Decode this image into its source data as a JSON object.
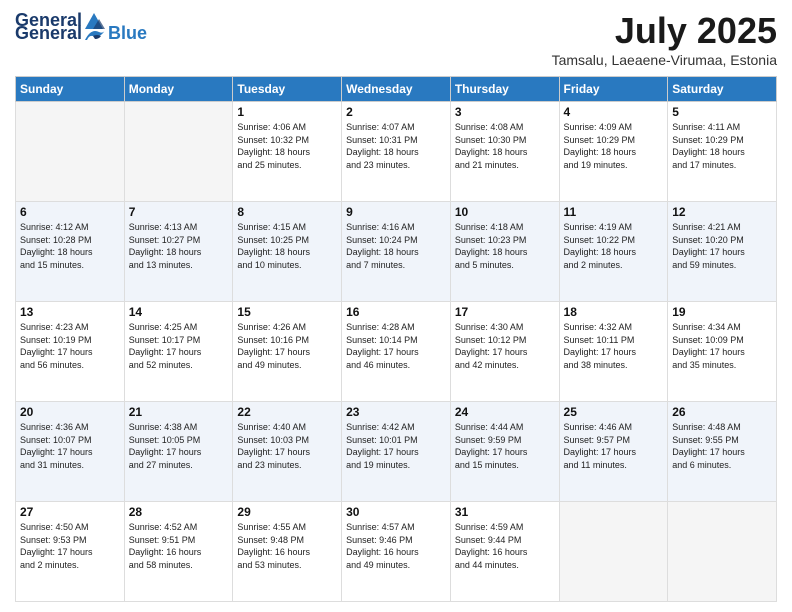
{
  "header": {
    "logo_general": "General",
    "logo_blue": "Blue",
    "title": "July 2025",
    "location": "Tamsalu, Laeaene-Virumaa, Estonia"
  },
  "days_of_week": [
    "Sunday",
    "Monday",
    "Tuesday",
    "Wednesday",
    "Thursday",
    "Friday",
    "Saturday"
  ],
  "weeks": [
    [
      {
        "day": "",
        "info": ""
      },
      {
        "day": "",
        "info": ""
      },
      {
        "day": "1",
        "info": "Sunrise: 4:06 AM\nSunset: 10:32 PM\nDaylight: 18 hours\nand 25 minutes."
      },
      {
        "day": "2",
        "info": "Sunrise: 4:07 AM\nSunset: 10:31 PM\nDaylight: 18 hours\nand 23 minutes."
      },
      {
        "day": "3",
        "info": "Sunrise: 4:08 AM\nSunset: 10:30 PM\nDaylight: 18 hours\nand 21 minutes."
      },
      {
        "day": "4",
        "info": "Sunrise: 4:09 AM\nSunset: 10:29 PM\nDaylight: 18 hours\nand 19 minutes."
      },
      {
        "day": "5",
        "info": "Sunrise: 4:11 AM\nSunset: 10:29 PM\nDaylight: 18 hours\nand 17 minutes."
      }
    ],
    [
      {
        "day": "6",
        "info": "Sunrise: 4:12 AM\nSunset: 10:28 PM\nDaylight: 18 hours\nand 15 minutes."
      },
      {
        "day": "7",
        "info": "Sunrise: 4:13 AM\nSunset: 10:27 PM\nDaylight: 18 hours\nand 13 minutes."
      },
      {
        "day": "8",
        "info": "Sunrise: 4:15 AM\nSunset: 10:25 PM\nDaylight: 18 hours\nand 10 minutes."
      },
      {
        "day": "9",
        "info": "Sunrise: 4:16 AM\nSunset: 10:24 PM\nDaylight: 18 hours\nand 7 minutes."
      },
      {
        "day": "10",
        "info": "Sunrise: 4:18 AM\nSunset: 10:23 PM\nDaylight: 18 hours\nand 5 minutes."
      },
      {
        "day": "11",
        "info": "Sunrise: 4:19 AM\nSunset: 10:22 PM\nDaylight: 18 hours\nand 2 minutes."
      },
      {
        "day": "12",
        "info": "Sunrise: 4:21 AM\nSunset: 10:20 PM\nDaylight: 17 hours\nand 59 minutes."
      }
    ],
    [
      {
        "day": "13",
        "info": "Sunrise: 4:23 AM\nSunset: 10:19 PM\nDaylight: 17 hours\nand 56 minutes."
      },
      {
        "day": "14",
        "info": "Sunrise: 4:25 AM\nSunset: 10:17 PM\nDaylight: 17 hours\nand 52 minutes."
      },
      {
        "day": "15",
        "info": "Sunrise: 4:26 AM\nSunset: 10:16 PM\nDaylight: 17 hours\nand 49 minutes."
      },
      {
        "day": "16",
        "info": "Sunrise: 4:28 AM\nSunset: 10:14 PM\nDaylight: 17 hours\nand 46 minutes."
      },
      {
        "day": "17",
        "info": "Sunrise: 4:30 AM\nSunset: 10:12 PM\nDaylight: 17 hours\nand 42 minutes."
      },
      {
        "day": "18",
        "info": "Sunrise: 4:32 AM\nSunset: 10:11 PM\nDaylight: 17 hours\nand 38 minutes."
      },
      {
        "day": "19",
        "info": "Sunrise: 4:34 AM\nSunset: 10:09 PM\nDaylight: 17 hours\nand 35 minutes."
      }
    ],
    [
      {
        "day": "20",
        "info": "Sunrise: 4:36 AM\nSunset: 10:07 PM\nDaylight: 17 hours\nand 31 minutes."
      },
      {
        "day": "21",
        "info": "Sunrise: 4:38 AM\nSunset: 10:05 PM\nDaylight: 17 hours\nand 27 minutes."
      },
      {
        "day": "22",
        "info": "Sunrise: 4:40 AM\nSunset: 10:03 PM\nDaylight: 17 hours\nand 23 minutes."
      },
      {
        "day": "23",
        "info": "Sunrise: 4:42 AM\nSunset: 10:01 PM\nDaylight: 17 hours\nand 19 minutes."
      },
      {
        "day": "24",
        "info": "Sunrise: 4:44 AM\nSunset: 9:59 PM\nDaylight: 17 hours\nand 15 minutes."
      },
      {
        "day": "25",
        "info": "Sunrise: 4:46 AM\nSunset: 9:57 PM\nDaylight: 17 hours\nand 11 minutes."
      },
      {
        "day": "26",
        "info": "Sunrise: 4:48 AM\nSunset: 9:55 PM\nDaylight: 17 hours\nand 6 minutes."
      }
    ],
    [
      {
        "day": "27",
        "info": "Sunrise: 4:50 AM\nSunset: 9:53 PM\nDaylight: 17 hours\nand 2 minutes."
      },
      {
        "day": "28",
        "info": "Sunrise: 4:52 AM\nSunset: 9:51 PM\nDaylight: 16 hours\nand 58 minutes."
      },
      {
        "day": "29",
        "info": "Sunrise: 4:55 AM\nSunset: 9:48 PM\nDaylight: 16 hours\nand 53 minutes."
      },
      {
        "day": "30",
        "info": "Sunrise: 4:57 AM\nSunset: 9:46 PM\nDaylight: 16 hours\nand 49 minutes."
      },
      {
        "day": "31",
        "info": "Sunrise: 4:59 AM\nSunset: 9:44 PM\nDaylight: 16 hours\nand 44 minutes."
      },
      {
        "day": "",
        "info": ""
      },
      {
        "day": "",
        "info": ""
      }
    ]
  ]
}
